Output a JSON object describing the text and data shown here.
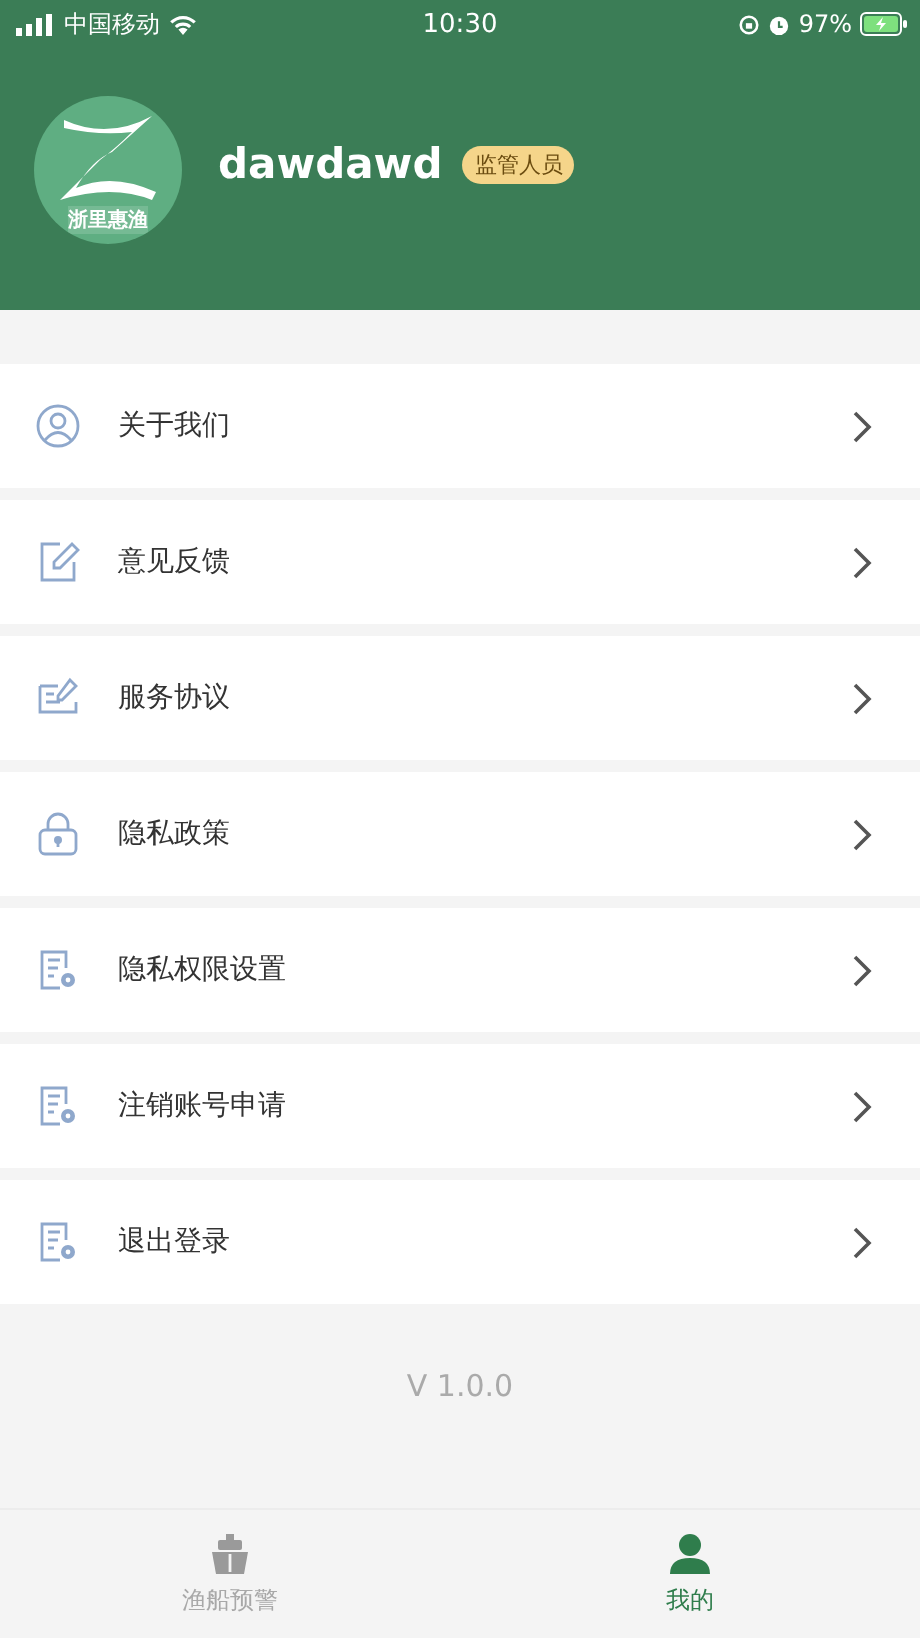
{
  "status_bar": {
    "carrier": "中国移动",
    "time": "10:30",
    "battery": "97%"
  },
  "profile": {
    "logo_text": "浙里惠渔",
    "username": "dawdawd",
    "role_badge": "监管人员"
  },
  "menu": [
    {
      "kind": "user",
      "label": "关于我们"
    },
    {
      "kind": "edit",
      "label": "意见反馈"
    },
    {
      "kind": "agreement",
      "label": "服务协议"
    },
    {
      "kind": "lock",
      "label": "隐私政策"
    },
    {
      "kind": "doc",
      "label": "隐私权限设置"
    },
    {
      "kind": "doc",
      "label": "注销账号申请"
    },
    {
      "kind": "doc",
      "label": "退出登录"
    }
  ],
  "version": "V 1.0.0",
  "tab_bar": [
    {
      "kind": "ship",
      "label": "渔船预警",
      "selected": false
    },
    {
      "kind": "person",
      "label": "我的",
      "selected": true
    }
  ]
}
